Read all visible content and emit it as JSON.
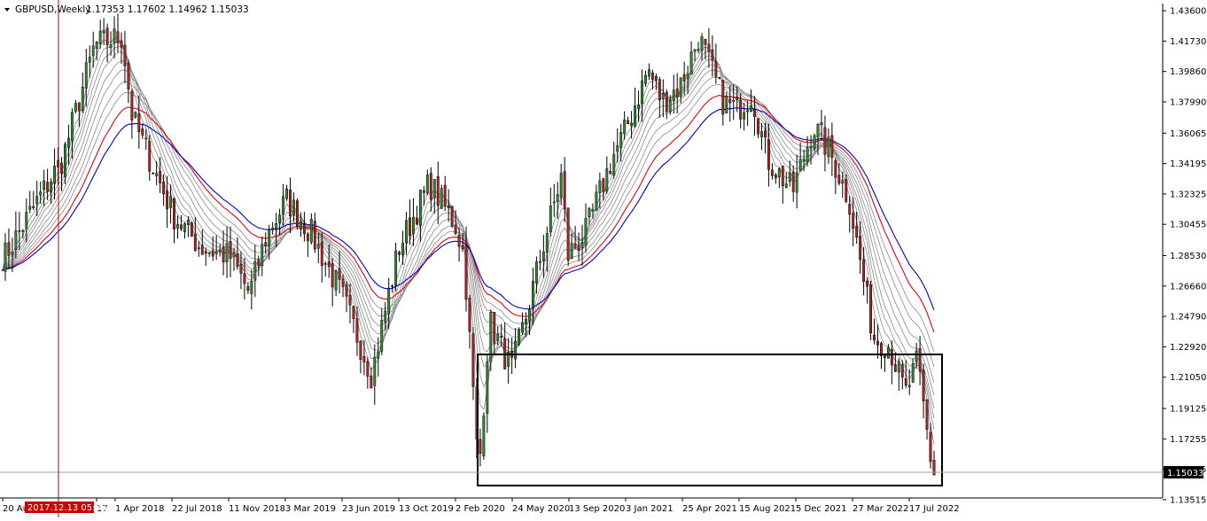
{
  "window": {
    "symbol_label": "GBPUSD,Weekly",
    "ohlc_label": "1.17353 1.17602 1.14962 1.15033"
  },
  "colors": {
    "bull_candle": "#2e8b2e",
    "bear_candle": "#b22222",
    "wick": "#000000",
    "ema_red": "#e8000b",
    "ema_blue": "#0000cc",
    "ema_gray": "#8a8a8a",
    "crosshair": "#cc0000",
    "price_line": "#a0a0a0"
  },
  "crosshair_label": "2017.12.13 05:30",
  "price_tag": "1.15033",
  "chart_data": {
    "type": "candlestick",
    "symbol": "GBPUSD",
    "timeframe": "Weekly",
    "ylim": [
      1.1362,
      1.4404
    ],
    "y_ticks": [
      "1.43600",
      "1.41730",
      "1.39860",
      "1.37990",
      "1.36065",
      "1.34195",
      "1.32325",
      "1.30455",
      "1.28530",
      "1.26660",
      "1.24790",
      "1.22920",
      "1.21050",
      "1.19125",
      "1.17255",
      "1.15385",
      "1.13515"
    ],
    "x_ticks": [
      "20 Aug",
      "17",
      "1 Apr 2018",
      "22 Jul 2018",
      "11 Nov 2018",
      "3 Mar 2019",
      "23 Jun 2019",
      "13 Oct 2019",
      "2 Feb 2020",
      "24 May 2020",
      "13 Sep 2020",
      "3 Jan 2021",
      "25 Apr 2021",
      "15 Aug 2021",
      "5 Dec 2021",
      "27 Mar 2022",
      "17 Jul 2022"
    ],
    "last_close": 1.15033,
    "key_points": [
      {
        "date": "2017-08-20",
        "close": 1.285
      },
      {
        "date": "2017-12-13",
        "close": 1.345
      },
      {
        "date": "2018-02-15",
        "close": 1.415
      },
      {
        "date": "2018-04-10",
        "close": 1.42
      },
      {
        "date": "2018-05-01",
        "close": 1.37
      },
      {
        "date": "2018-07-22",
        "close": 1.31
      },
      {
        "date": "2018-09-15",
        "close": 1.29
      },
      {
        "date": "2018-11-11",
        "close": 1.285
      },
      {
        "date": "2018-12-20",
        "close": 1.262
      },
      {
        "date": "2019-01-20",
        "close": 1.295
      },
      {
        "date": "2019-03-03",
        "close": 1.32
      },
      {
        "date": "2019-04-20",
        "close": 1.3
      },
      {
        "date": "2019-06-23",
        "close": 1.26
      },
      {
        "date": "2019-08-20",
        "close": 1.212
      },
      {
        "date": "2019-09-15",
        "close": 1.25
      },
      {
        "date": "2019-10-13",
        "close": 1.29
      },
      {
        "date": "2019-12-13",
        "close": 1.33
      },
      {
        "date": "2020-02-02",
        "close": 1.305
      },
      {
        "date": "2020-02-20",
        "close": 1.285
      },
      {
        "date": "2020-03-20",
        "close": 1.15
      },
      {
        "date": "2020-04-10",
        "close": 1.245
      },
      {
        "date": "2020-05-24",
        "close": 1.215
      },
      {
        "date": "2020-06-20",
        "close": 1.245
      },
      {
        "date": "2020-07-25",
        "close": 1.29
      },
      {
        "date": "2020-09-01",
        "close": 1.335
      },
      {
        "date": "2020-09-13",
        "close": 1.285
      },
      {
        "date": "2020-10-20",
        "close": 1.3
      },
      {
        "date": "2020-12-10",
        "close": 1.345
      },
      {
        "date": "2021-01-03",
        "close": 1.36
      },
      {
        "date": "2021-02-20",
        "close": 1.4
      },
      {
        "date": "2021-03-20",
        "close": 1.38
      },
      {
        "date": "2021-04-25",
        "close": 1.39
      },
      {
        "date": "2021-06-01",
        "close": 1.42
      },
      {
        "date": "2021-07-20",
        "close": 1.38
      },
      {
        "date": "2021-08-15",
        "close": 1.375
      },
      {
        "date": "2021-09-15",
        "close": 1.385
      },
      {
        "date": "2021-10-15",
        "close": 1.345
      },
      {
        "date": "2021-12-05",
        "close": 1.325
      },
      {
        "date": "2022-01-15",
        "close": 1.365
      },
      {
        "date": "2022-02-15",
        "close": 1.35
      },
      {
        "date": "2022-03-27",
        "close": 1.32
      },
      {
        "date": "2022-05-15",
        "close": 1.235
      },
      {
        "date": "2022-06-15",
        "close": 1.23
      },
      {
        "date": "2022-07-17",
        "close": 1.2
      },
      {
        "date": "2022-08-10",
        "close": 1.22
      },
      {
        "date": "2022-09-10",
        "close": 1.15
      }
    ]
  }
}
